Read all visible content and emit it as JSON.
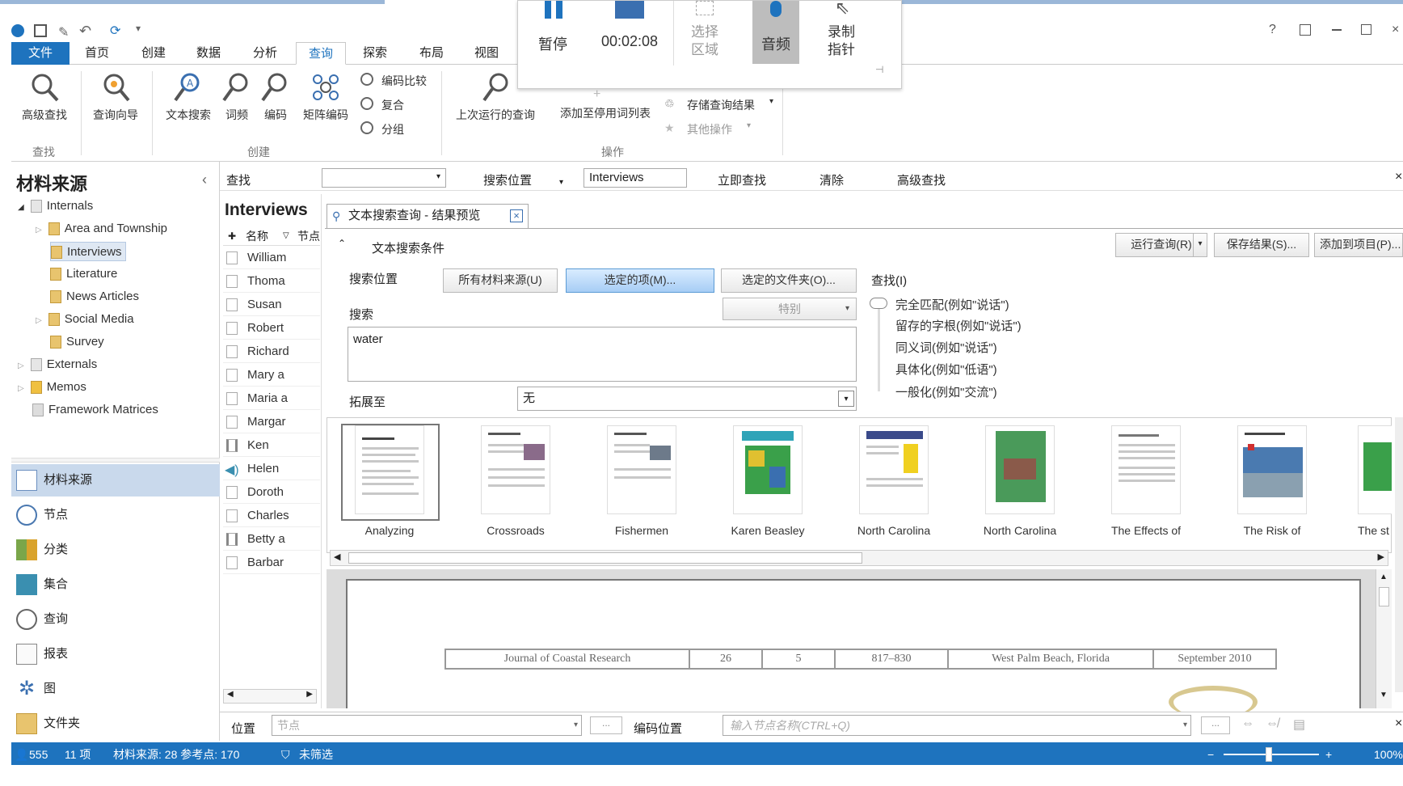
{
  "recorder": {
    "pause_label": "暂停",
    "timer": "00:02:08",
    "select_area_label": "选择\n区域",
    "audio_label": "音频",
    "record_pointer_label": "录制\n指针"
  },
  "tabs": [
    {
      "label": "文件"
    },
    {
      "label": "首页"
    },
    {
      "label": "创建"
    },
    {
      "label": "数据"
    },
    {
      "label": "分析"
    },
    {
      "label": "查询"
    },
    {
      "label": "探索"
    },
    {
      "label": "布局"
    },
    {
      "label": "视图"
    }
  ],
  "window_controls": {
    "help": "?"
  },
  "ribbon": {
    "find_group": {
      "label": "查找",
      "advanced_find": "高级查找",
      "query_wizard": "查询向导"
    },
    "create_group": {
      "label": "创建",
      "text_search": "文本搜索",
      "word_freq": "词频",
      "coding": "编码",
      "matrix_coding": "矩阵编码",
      "coding_compare": "编码比较",
      "compound": "复合",
      "group": "分组"
    },
    "actions_group": {
      "label": "操作",
      "last_query": "上次运行的查询",
      "add_stopwords": "添加至停用词列表",
      "store_results": "存储查询结果",
      "other_actions": "其他操作"
    }
  },
  "left_panel": {
    "title": "材料来源",
    "tree": [
      {
        "label": "Internals",
        "level": 0
      },
      {
        "label": "Area and Township",
        "level": 1
      },
      {
        "label": "Interviews",
        "level": 1,
        "selected": true
      },
      {
        "label": "Literature",
        "level": 1
      },
      {
        "label": "News Articles",
        "level": 1
      },
      {
        "label": "Social Media",
        "level": 1
      },
      {
        "label": "Survey",
        "level": 1
      },
      {
        "label": "Externals",
        "level": 0
      },
      {
        "label": "Memos",
        "level": 0
      },
      {
        "label": "Framework Matrices",
        "level": 0
      }
    ],
    "nav": [
      {
        "label": "材料来源",
        "icon": "sources-icon",
        "active": true
      },
      {
        "label": "节点",
        "icon": "nodes-icon"
      },
      {
        "label": "分类",
        "icon": "classifications-icon"
      },
      {
        "label": "集合",
        "icon": "collections-icon"
      },
      {
        "label": "查询",
        "icon": "queries-icon"
      },
      {
        "label": "报表",
        "icon": "reports-icon"
      },
      {
        "label": "图",
        "icon": "maps-icon"
      },
      {
        "label": "文件夹",
        "icon": "folder-icon"
      }
    ]
  },
  "find_bar": {
    "label": "查找",
    "search_in_label": "搜索位置",
    "search_in_value": "Interviews",
    "find_now": "立即查找",
    "clear": "清除",
    "advanced": "高级查找"
  },
  "middle_list": {
    "title": "Interviews",
    "col_name": "名称",
    "col_nodes": "节点",
    "items": [
      "William",
      "Thoma",
      "Susan",
      "Robert",
      "Richard",
      "Mary a",
      "Maria a",
      "Margar",
      "Ken",
      "Helen",
      "Doroth",
      "Charles",
      "Betty a",
      "Barbar"
    ]
  },
  "query_tab": {
    "title": "文本搜索查询 - 结果预览",
    "criteria_label": "文本搜索条件",
    "run_query": "运行查询(R)",
    "save_results": "保存结果(S)...",
    "add_to_project": "添加到项目(P)...",
    "search_in_label": "搜索位置",
    "all_sources": "所有材料来源(U)",
    "selected_items": "选定的项(M)...",
    "selected_folders": "选定的文件夹(O)...",
    "search_label": "搜索",
    "special": "特别",
    "search_text": "water",
    "expand_label": "拓展至",
    "expand_value": "无",
    "find_label": "查找(I)",
    "options": [
      "完全匹配(例如\"说话\")",
      "留存的字根(例如\"说话\")",
      "同义词(例如\"说话\")",
      "具体化(例如\"低语\")",
      "一般化(例如\"交流\")"
    ],
    "thumbnails": [
      {
        "title": "Analyzing"
      },
      {
        "title": "Crossroads"
      },
      {
        "title": "Fishermen"
      },
      {
        "title": "Karen Beasley"
      },
      {
        "title": "North Carolina"
      },
      {
        "title": "North Carolina"
      },
      {
        "title": "The Effects of"
      },
      {
        "title": "The Risk of"
      },
      {
        "title": "The st"
      }
    ],
    "preview_table": [
      "Journal of Coastal Research",
      "26",
      "5",
      "817–830",
      "West Palm Beach, Florida",
      "September 2010"
    ]
  },
  "bottom_bar": {
    "location_label": "位置",
    "location_value": "节点",
    "code_at_label": "编码位置",
    "code_placeholder": "输入节点名称(CTRL+Q)"
  },
  "status": {
    "user": "555",
    "items": "11 项",
    "sources": "材料来源: 28 参考点: 170",
    "filter": "未筛选",
    "zoom": "100%"
  }
}
